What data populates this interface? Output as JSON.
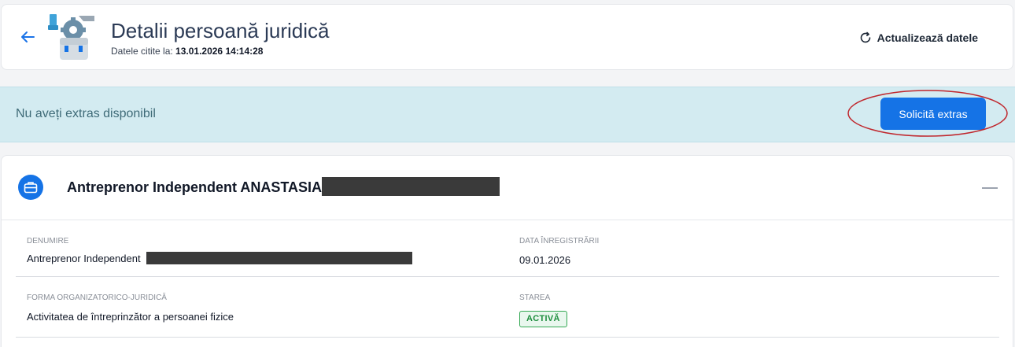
{
  "header": {
    "title": "Detalii persoană juridică",
    "subtitle_prefix": "Datele citite la:",
    "read_timestamp": "13.01.2026 14:14:28",
    "refresh_label": "Actualizează datele"
  },
  "banner": {
    "message": "Nu aveți extras disponibil",
    "request_button": "Solicită extras"
  },
  "entity": {
    "name": "Antreprenor Independent ANASTASIA",
    "fields": {
      "denumire_label": "DENUMIRE",
      "denumire_value": "Antreprenor Independent",
      "data_label": "DATA ÎNREGISTRĂRII",
      "data_value": "09.01.2026",
      "forma_label": "FORMA ORGANIZATORICO-JURIDICĂ",
      "forma_value": "Activitatea de întreprinzător a persoanei fizice",
      "starea_label": "STAREA",
      "starea_value": "ACTIVĂ"
    }
  },
  "colors": {
    "accent": "#1573e6",
    "banner_bg": "#d3ebf1",
    "status_green": "#1e8e3e",
    "annotation_red": "#c0272d",
    "redaction": "#3a3a3a"
  },
  "icons": {
    "back": "arrow-left-icon",
    "illustration": "legal-entity-briefcase-illustration",
    "refresh": "refresh-icon",
    "entity": "briefcase-icon",
    "collapse": "minus-icon"
  }
}
